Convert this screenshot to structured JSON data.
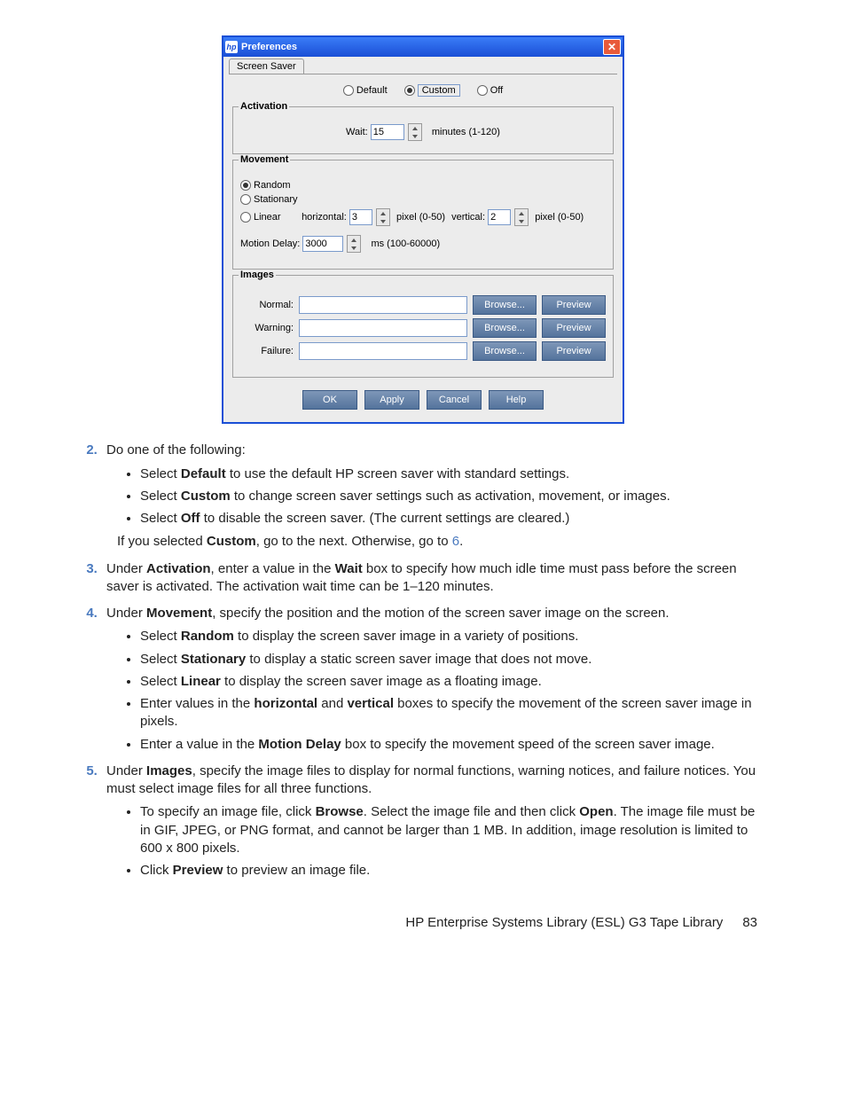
{
  "window": {
    "title": "Preferences",
    "close": "✕",
    "tab": "Screen Saver",
    "modes": {
      "default": "Default",
      "custom": "Custom",
      "off": "Off"
    },
    "activation": {
      "legend": "Activation",
      "wait_label": "Wait:",
      "wait_value": "15",
      "wait_hint": "minutes (1-120)"
    },
    "movement": {
      "legend": "Movement",
      "random": "Random",
      "stationary": "Stationary",
      "linear": "Linear",
      "horizontal_label": "horizontal:",
      "horizontal_value": "3",
      "vertical_label": "vertical:",
      "vertical_value": "2",
      "pixel_hint": "pixel (0-50)",
      "motion_delay_label": "Motion Delay:",
      "motion_delay_value": "3000",
      "motion_delay_hint": "ms (100-60000)"
    },
    "images": {
      "legend": "Images",
      "rows": [
        {
          "label": "Normal:"
        },
        {
          "label": "Warning:"
        },
        {
          "label": "Failure:"
        }
      ],
      "browse": "Browse...",
      "preview": "Preview"
    },
    "buttons": {
      "ok": "OK",
      "apply": "Apply",
      "cancel": "Cancel",
      "help": "Help"
    }
  },
  "doc": {
    "s2": {
      "lead": "Do one of the following:",
      "b1a": "Select ",
      "b1b": "Default",
      "b1c": " to use the default HP screen saver with standard settings.",
      "b2a": "Select ",
      "b2b": "Custom",
      "b2c": " to change screen saver settings such as activation, movement, or images.",
      "b3a": "Select ",
      "b3b": "Off",
      "b3c": " to disable the screen saver. (The current settings are cleared.)",
      "after_a": "If you selected ",
      "after_b": "Custom",
      "after_c": ", go to the next. Otherwise, go to ",
      "after_link": "6",
      "after_d": "."
    },
    "s3": {
      "a": "Under ",
      "b": "Activation",
      "c": ", enter a value in the ",
      "d": "Wait",
      "e": " box to specify how much idle time must pass before the screen saver is activated. The activation wait time can be 1–120 minutes."
    },
    "s4": {
      "a": "Under ",
      "b": "Movement",
      "c": ", specify the position and the motion of the screen saver image on the screen.",
      "b1a": "Select ",
      "b1b": "Random",
      "b1c": " to display the screen saver image in a variety of positions.",
      "b2a": "Select ",
      "b2b": "Stationary",
      "b2c": " to display a static screen saver image that does not move.",
      "b3a": "Select ",
      "b3b": "Linear",
      "b3c": " to display the screen saver image as a floating image.",
      "b4a": "Enter values in the ",
      "b4b": "horizontal",
      "b4c": " and ",
      "b4d": "vertical",
      "b4e": " boxes to specify the movement of the screen saver image in pixels.",
      "b5a": "Enter a value in the ",
      "b5b": "Motion Delay",
      "b5c": " box to specify the movement speed of the screen saver image."
    },
    "s5": {
      "a": "Under ",
      "b": "Images",
      "c": ", specify the image files to display for normal functions, warning notices, and failure notices. You must select image files for all three functions.",
      "b1a": "To specify an image file, click ",
      "b1b": "Browse",
      "b1c": ". Select the image file and then click ",
      "b1d": "Open",
      "b1e": ". The image file must be in GIF, JPEG, or PNG format, and cannot be larger than 1 MB. In addition, image resolution is limited to 600 x 800 pixels.",
      "b2a": "Click ",
      "b2b": "Preview",
      "b2c": " to preview an image file."
    }
  },
  "footer": {
    "title": "HP Enterprise Systems Library (ESL) G3 Tape Library",
    "page": "83"
  }
}
